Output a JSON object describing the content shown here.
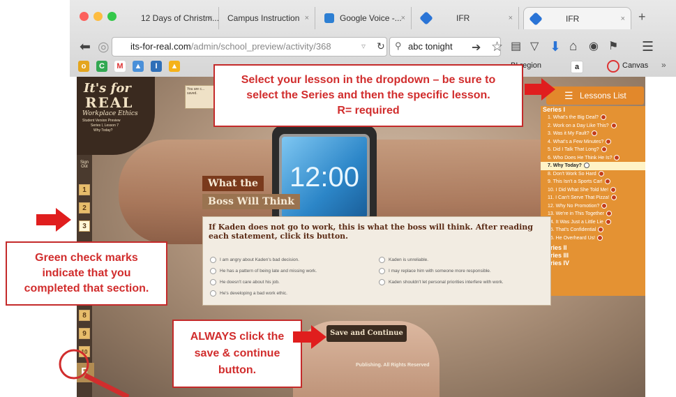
{
  "browser": {
    "tabs": [
      {
        "label": "12 Days of Christm...",
        "close": "×"
      },
      {
        "label": "Campus Instruction",
        "close": "×"
      },
      {
        "label": "Google Voice -...",
        "close": "×"
      },
      {
        "label": "IFR",
        "close": "×"
      },
      {
        "label": "IFR",
        "close": "×"
      }
    ],
    "new_tab": "+",
    "url_host": "its-for-real.com",
    "url_path": "/admin/school_preview/activity/368",
    "search_value": "abc tonight",
    "bookmarks_visible": [
      "BLregion",
      "Canvas"
    ],
    "bookmarks_overflow": "»"
  },
  "app": {
    "logo": {
      "line1": "It's for",
      "line2": "REAL",
      "line3": "Workplace Ethics",
      "line4": "Student Version Preview",
      "line5": "Series I, Lesson 7",
      "line6": "Why Today?"
    },
    "sign_out": "Sign Out",
    "nav_numbers": [
      "1",
      "2",
      "3",
      "8",
      "9",
      "10"
    ],
    "final_label": "F",
    "watch_time": "12:00",
    "notice": "You are c... saved.",
    "lessons_button": "Lessons List",
    "series": [
      "Series I",
      "Series II",
      "Series III",
      "Series IV"
    ],
    "lessons": [
      "1. What's the Big Deal?",
      "2. Work on a Day Like This?",
      "3. Was it My Fault?",
      "4. What's a Few Minutes?",
      "5. Did I Talk That Long?",
      "6. Who Does He Think He Is?",
      "7. Why Today?",
      "8. Don't Work So Hard",
      "9. This Isn't a Sports Car!",
      "10. I Did What She Told Me!",
      "11. I Can't Serve That Pizza!",
      "12. Why No Promotion?",
      "13. We're in This Together",
      "14. It Was Just a Little Lie",
      "15. That's Confidential",
      "16. He Overheard Us!"
    ],
    "selected_lesson": "7. Why Today?",
    "heading_line1": "What the",
    "heading_line2": "Boss Will Think",
    "question": "If Kaden does not go to work, this is what the boss will think. After reading each statement, click its button.",
    "options_left": [
      "I am angry about Kaden's bad decision.",
      "He has a pattern of being late and missing work.",
      "He doesn't care about his job.",
      "He's developing a bad work ethic."
    ],
    "options_right": [
      "Kaden is unreliable.",
      "I may replace him with someone more responsible.",
      "Kaden shouldn't let personal priorities interfere with work."
    ],
    "save_button": "Save and Continue",
    "footer": "Publishing. All Rights Reserved"
  },
  "callouts": {
    "top": [
      "Select your lesson in the dropdown – be sure to",
      "select the Series and then the specific lesson.",
      "R= required"
    ],
    "left": [
      "Green check marks",
      "indicate that you",
      "completed that section."
    ],
    "bottom": [
      "ALWAYS click the",
      "save & continue",
      "button."
    ]
  },
  "colors": {
    "callout_red": "#d12d2d",
    "lessons_orange": "#e49233",
    "brown": "#3b2c20"
  }
}
